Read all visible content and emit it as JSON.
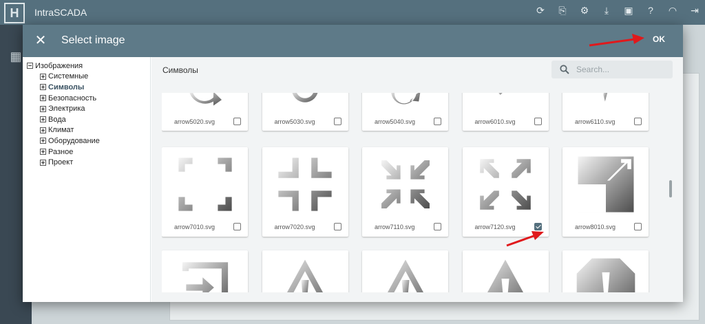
{
  "app": {
    "name": "IntraSCADA",
    "logo_letter": "H",
    "toolbar_icons": [
      "refresh-icon",
      "export-icon",
      "gear-icon",
      "download-icon",
      "lock-icon",
      "help-icon",
      "wifi-icon",
      "logout-icon"
    ],
    "sidebar_icons": [
      "dashboard-icon",
      "monitor-icon",
      "document-icon",
      "grid-icon",
      "chart-icon",
      "database-icon",
      "layers-icon",
      "user-icon"
    ]
  },
  "dialog": {
    "title": "Select image",
    "ok_label": "OK",
    "close_glyph": "✕"
  },
  "tree": {
    "root": "Изображения",
    "children": [
      "Системные",
      "Символы",
      "Безопасность",
      "Электрика",
      "Вода",
      "Климат",
      "Оборудование",
      "Разное",
      "Проект"
    ],
    "selected": "Символы"
  },
  "content": {
    "title": "Символы",
    "search_placeholder": "Search..."
  },
  "images": [
    {
      "name": "arrow5020.svg",
      "checked": false
    },
    {
      "name": "arrow5030.svg",
      "checked": false
    },
    {
      "name": "arrow5040.svg",
      "checked": false
    },
    {
      "name": "arrow6010.svg",
      "checked": false
    },
    {
      "name": "arrow6110.svg",
      "checked": false
    },
    {
      "name": "arrow7010.svg",
      "checked": false
    },
    {
      "name": "arrow7020.svg",
      "checked": false
    },
    {
      "name": "arrow7110.svg",
      "checked": false
    },
    {
      "name": "arrow7120.svg",
      "checked": true
    },
    {
      "name": "arrow8010.svg",
      "checked": false
    }
  ],
  "annotation_color": "#e0191c",
  "accent_color": "#5e7a88"
}
